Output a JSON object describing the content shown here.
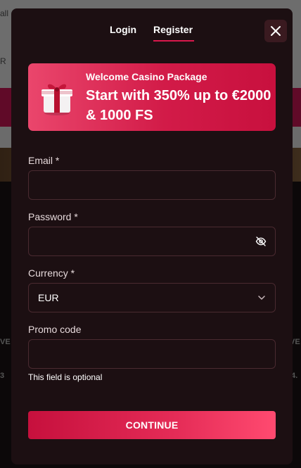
{
  "background": {
    "fragments": [
      "all",
      "R",
      "VE",
      "VE",
      "3",
      "4."
    ]
  },
  "tabs": [
    {
      "label": "Login",
      "active": false
    },
    {
      "label": "Register",
      "active": true
    }
  ],
  "close_icon": "close-icon",
  "banner": {
    "kicker": "Welcome Casino Package",
    "title": "Start with 350% up to €2000 & 1000 FS",
    "icon": "gift-icon"
  },
  "form": {
    "email": {
      "label": "Email *",
      "value": "",
      "placeholder": ""
    },
    "password": {
      "label": "Password *",
      "value": "",
      "placeholder": "",
      "icon": "eye-off-icon"
    },
    "currency": {
      "label": "Currency *",
      "selected": "EUR",
      "icon": "chevron-down-icon"
    },
    "promo": {
      "label": "Promo code",
      "value": "",
      "placeholder": "",
      "hint": "This field is optional"
    }
  },
  "submit": {
    "label": "CONTINUE"
  },
  "colors": {
    "accent": "#d8184c",
    "modal_bg": "#1c0f12",
    "field_border": "#4a2a30"
  }
}
